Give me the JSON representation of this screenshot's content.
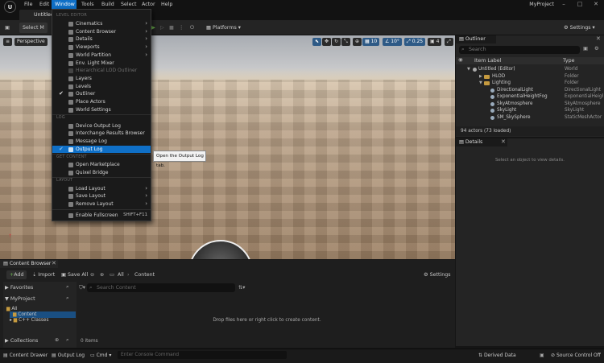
{
  "menubar": {
    "items": [
      "File",
      "Edit",
      "Window",
      "Tools",
      "Build",
      "Select",
      "Actor",
      "Help"
    ],
    "project_name": "MyProject"
  },
  "tabs": {
    "level": "Untitled"
  },
  "toolbar": {
    "select_mode": "Select M",
    "platforms": "Platforms",
    "settings": "Settings"
  },
  "viewport": {
    "perspective": "Perspective",
    "grid_snap": "10",
    "rotation_snap": "10°",
    "scale_snap": "0.25",
    "camera_speed": "4"
  },
  "window_menu": {
    "sections": [
      "LEVEL EDITOR",
      "LOG",
      "GET CONTENT",
      "LAYOUT"
    ],
    "level_editor": [
      {
        "label": "Cinematics",
        "submenu": true
      },
      {
        "label": "Content Browser",
        "submenu": true
      },
      {
        "label": "Details",
        "submenu": true
      },
      {
        "label": "Viewports",
        "submenu": true
      },
      {
        "label": "World Partition",
        "submenu": true
      },
      {
        "label": "Env. Light Mixer"
      },
      {
        "label": "Hierarchical LOD Outliner",
        "disabled": true
      },
      {
        "label": "Layers"
      },
      {
        "label": "Levels"
      },
      {
        "label": "Outliner",
        "checked": true
      },
      {
        "label": "Place Actors"
      },
      {
        "label": "World Settings"
      }
    ],
    "log": [
      {
        "label": "Device Output Log"
      },
      {
        "label": "Interchange Results Browser"
      },
      {
        "label": "Message Log"
      },
      {
        "label": "Output Log",
        "highlighted": true
      }
    ],
    "get_content": [
      {
        "label": "Open Marketplace"
      },
      {
        "label": "Quixel Bridge"
      }
    ],
    "layout": [
      {
        "label": "Load Layout",
        "submenu": true
      },
      {
        "label": "Save Layout",
        "submenu": true
      },
      {
        "label": "Remove Layout",
        "submenu": true
      },
      {
        "label": "Enable Fullscreen",
        "shortcut": "SHIFT+F11"
      }
    ],
    "tooltip": "Open the Output Log tab."
  },
  "outliner": {
    "title": "Outliner",
    "search_placeholder": "Search",
    "col_label": "Item Label",
    "col_type": "Type",
    "rows": [
      {
        "label": "Untitled (Editor)",
        "type": "World"
      },
      {
        "label": "HLOD",
        "type": "Folder"
      },
      {
        "label": "Lighting",
        "type": "Folder"
      },
      {
        "label": "DirectionalLight",
        "type": "DirectionalLight"
      },
      {
        "label": "ExponentialHeightFog",
        "type": "ExponentialHeightFog"
      },
      {
        "label": "SkyAtmosphere",
        "type": "SkyAtmosphere"
      },
      {
        "label": "SkyLight",
        "type": "SkyLight"
      },
      {
        "label": "SM_SkySphere",
        "type": "StaticMeshActor"
      }
    ],
    "count": "94 actors (73 loaded)"
  },
  "details": {
    "title": "Details",
    "empty_text": "Select an object to view details."
  },
  "content_browser": {
    "title": "Content Browser",
    "add": "Add",
    "import": "Import",
    "save_all": "Save All",
    "path": [
      "All",
      "Content"
    ],
    "settings": "Settings",
    "favorites": "Favorites",
    "project": "MyProject",
    "tree": [
      "All",
      "Content",
      "C++ Classes"
    ],
    "search_placeholder": "Search Content",
    "drop_text": "Drop files here or right click to create content.",
    "items_count": "0 items",
    "collections": "Collections"
  },
  "statusbar": {
    "content_drawer": "Content Drawer",
    "output_log": "Output Log",
    "cmd": "Cmd",
    "console_placeholder": "Enter Console Command",
    "derived_data": "Derived Data",
    "source_control": "Source Control Off"
  }
}
